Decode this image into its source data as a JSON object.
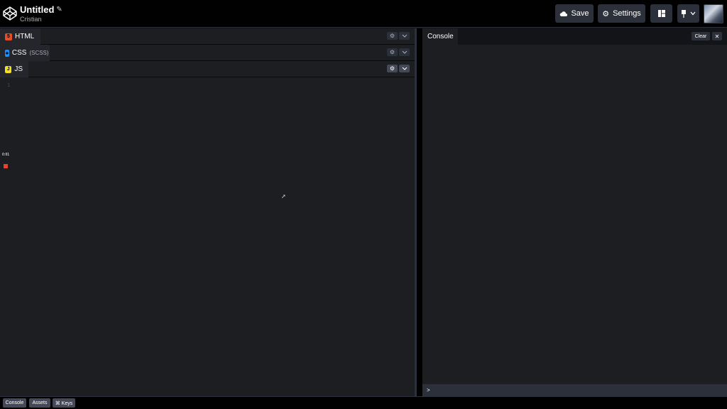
{
  "header": {
    "title": "Untitled",
    "author": "Cristian",
    "save_label": "Save",
    "settings_label": "Settings"
  },
  "editors": [
    {
      "label": "HTML",
      "sub": "",
      "badge": "5"
    },
    {
      "label": "CSS",
      "sub": "(SCSS)",
      "badge": "∗"
    },
    {
      "label": "JS",
      "sub": "",
      "badge": "J"
    }
  ],
  "code": {
    "line_number": "1",
    "timer": "0:01"
  },
  "console": {
    "tab_label": "Console",
    "clear_label": "Clear",
    "close_label": "✕",
    "prompt": ">"
  },
  "footer": {
    "console_label": "Console",
    "assets_label": "Assets",
    "keys_label": "⌘ Keys"
  },
  "colors": {
    "html": "#e44d26",
    "css": "#1e90ff",
    "js": "#f7df1e",
    "background": "#1d1e22"
  }
}
